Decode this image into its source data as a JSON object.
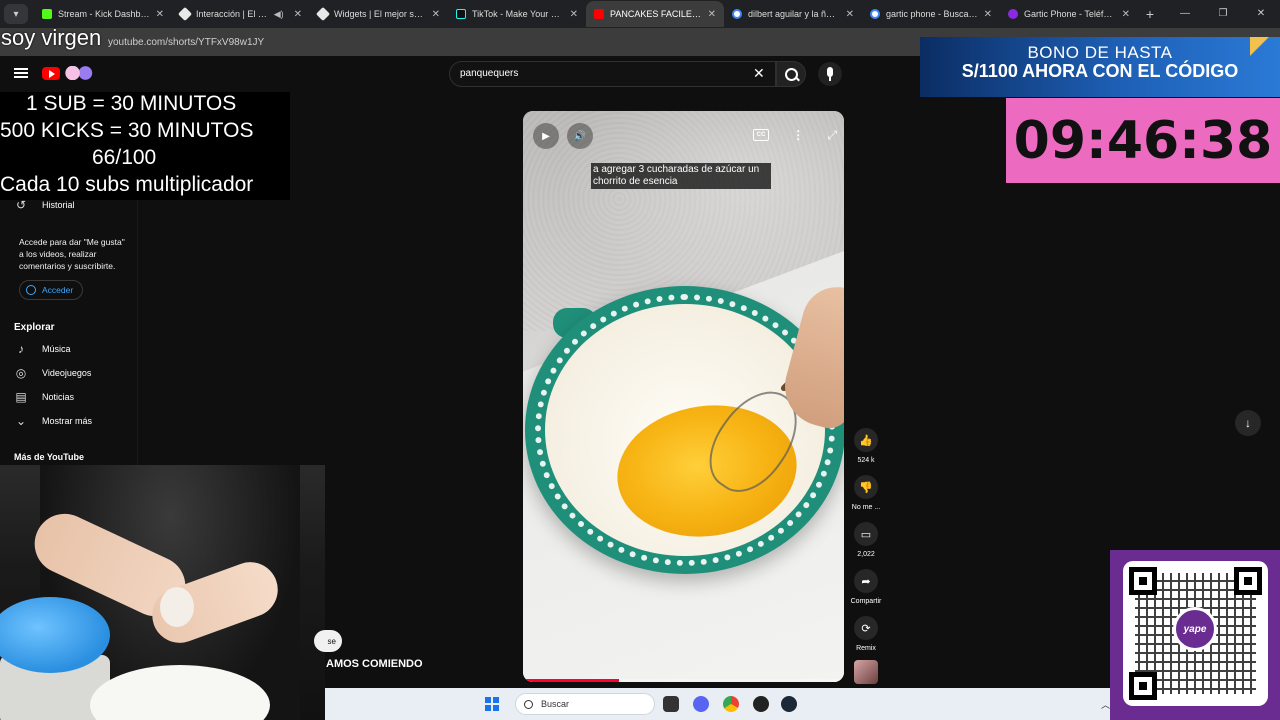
{
  "browser": {
    "tabs": [
      {
        "title": "Stream - Kick Dashboard",
        "favicon_color": "#53fc18"
      },
      {
        "title": "Interacción | El mejor",
        "favicon_color": "#e8e8e8"
      },
      {
        "title": "Widgets | El mejor softwa",
        "favicon_color": "#e8e8e8"
      },
      {
        "title": "TikTok - Make Your Day",
        "favicon_color": "#111111"
      },
      {
        "title": "PANCAKES FACILES | LA P",
        "favicon_color": "#ff0000"
      },
      {
        "title": "dilbert aguilar y la ñañita",
        "favicon_color": "#4285f4"
      },
      {
        "title": "gartic phone - Buscar con",
        "favicon_color": "#4285f4"
      },
      {
        "title": "Gartic Phone - Teléfono D",
        "favicon_color": "#8a2be2"
      }
    ],
    "url": "youtube.com/shorts/YTFxV98w1JY"
  },
  "youtube": {
    "search_value": "panquequers",
    "sidebar": {
      "history": "Historial",
      "signin_note": "Accede para dar \"Me gusta\" a los videos, realizar comentarios y suscribirte.",
      "signin_button": "Acceder",
      "explore_heading": "Explorar",
      "explore_items": [
        "Música",
        "Videojuegos",
        "Noticias",
        "Mostrar más"
      ],
      "more_heading": "Más de YouTube"
    },
    "short": {
      "caption": "a agregar 3 cucharadas de azúcar un chorrito de esencia",
      "progress_fraction": 0.3
    },
    "actions": {
      "likes": "524 k",
      "dislike": "No me ...",
      "comments": "2,022",
      "share": "Compartir",
      "remix": "Remix"
    }
  },
  "overlay": {
    "streamer_text": "soy virgen",
    "goals": [
      "1 SUB      = 30 MINUTOS",
      "500 KICKS = 30 MINUTOS",
      "66/100",
      "Cada 10 subs multiplicador"
    ],
    "promo_line1": "BONO DE HASTA",
    "promo_line2": "S/1100 AHORA CON EL CÓDIGO",
    "timer": "09:46:38",
    "cam_caption": "AMOS COMIENDO",
    "pill_text": "se",
    "qr_brand": "yape"
  },
  "taskbar": {
    "search_label": "Buscar"
  }
}
